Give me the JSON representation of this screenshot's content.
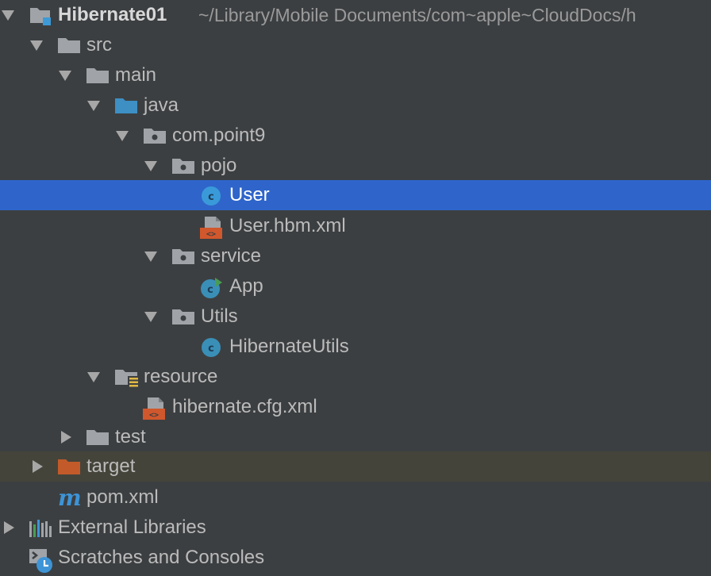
{
  "project": {
    "name": "Hibernate01",
    "path": "~/Library/Mobile Documents/com~apple~CloudDocs/h"
  },
  "nodes": {
    "src": "src",
    "main": "main",
    "java": "java",
    "com_point9": "com.point9",
    "pojo": "pojo",
    "user": "User",
    "user_hbm": "User.hbm.xml",
    "service": "service",
    "app": "App",
    "utils": "Utils",
    "hibernate_utils": "HibernateUtils",
    "resource": "resource",
    "hibernate_cfg": "hibernate.cfg.xml",
    "test": "test",
    "target": "target",
    "pom": "pom.xml",
    "external_libraries": "External Libraries",
    "scratches": "Scratches and Consoles"
  },
  "icons": {
    "folder": "folder-icon",
    "package": "package-icon",
    "source_root": "source-root-folder-icon",
    "resource_root": "resource-root-folder-icon",
    "excluded": "excluded-folder-icon",
    "class": "java-class-icon",
    "runnable": "runnable-class-icon",
    "xml": "xml-file-icon",
    "maven": "maven-pom-icon",
    "libraries": "libraries-icon",
    "scratches": "scratches-icon"
  },
  "colors": {
    "background": "#3c3f41",
    "selection": "#2f65ca",
    "excluded_row": "#45443a",
    "folder": "#a0a4a8",
    "source_folder": "#3d8fc4",
    "excluded_folder": "#c25b29",
    "class_icon": "#3a8fb7",
    "xml_icon": "#d1572c",
    "maven": "#3d94d6"
  }
}
